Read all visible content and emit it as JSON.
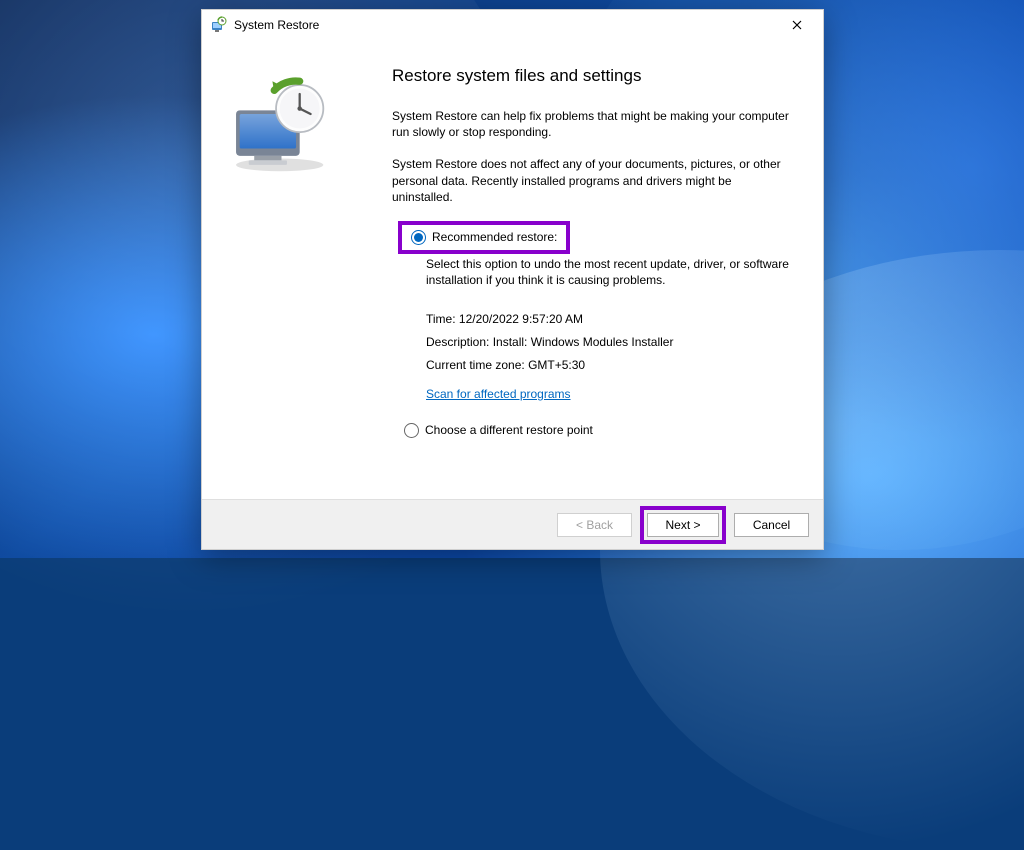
{
  "titlebar": {
    "title": "System Restore"
  },
  "page": {
    "heading": "Restore system files and settings",
    "intro1": "System Restore can help fix problems that might be making your computer run slowly or stop responding.",
    "intro2": "System Restore does not affect any of your documents, pictures, or other personal data. Recently installed programs and drivers might be uninstalled."
  },
  "option_recommended": {
    "label": "Recommended restore:",
    "help": "Select this option to undo the most recent update, driver, or software installation if you think it is causing problems.",
    "time_label": "Time:",
    "time_value": "12/20/2022 9:57:20 AM",
    "description_label": "Description:",
    "description_value": "Install: Windows Modules Installer",
    "tz_label": "Current time zone:",
    "tz_value": "GMT+5:30",
    "scan_link": "Scan for affected programs"
  },
  "option_choose": {
    "label": "Choose a different restore point"
  },
  "buttons": {
    "back": "< Back",
    "next": "Next >",
    "cancel": "Cancel"
  },
  "colors": {
    "accent": "#0067c0",
    "highlight": "#8800cc"
  }
}
